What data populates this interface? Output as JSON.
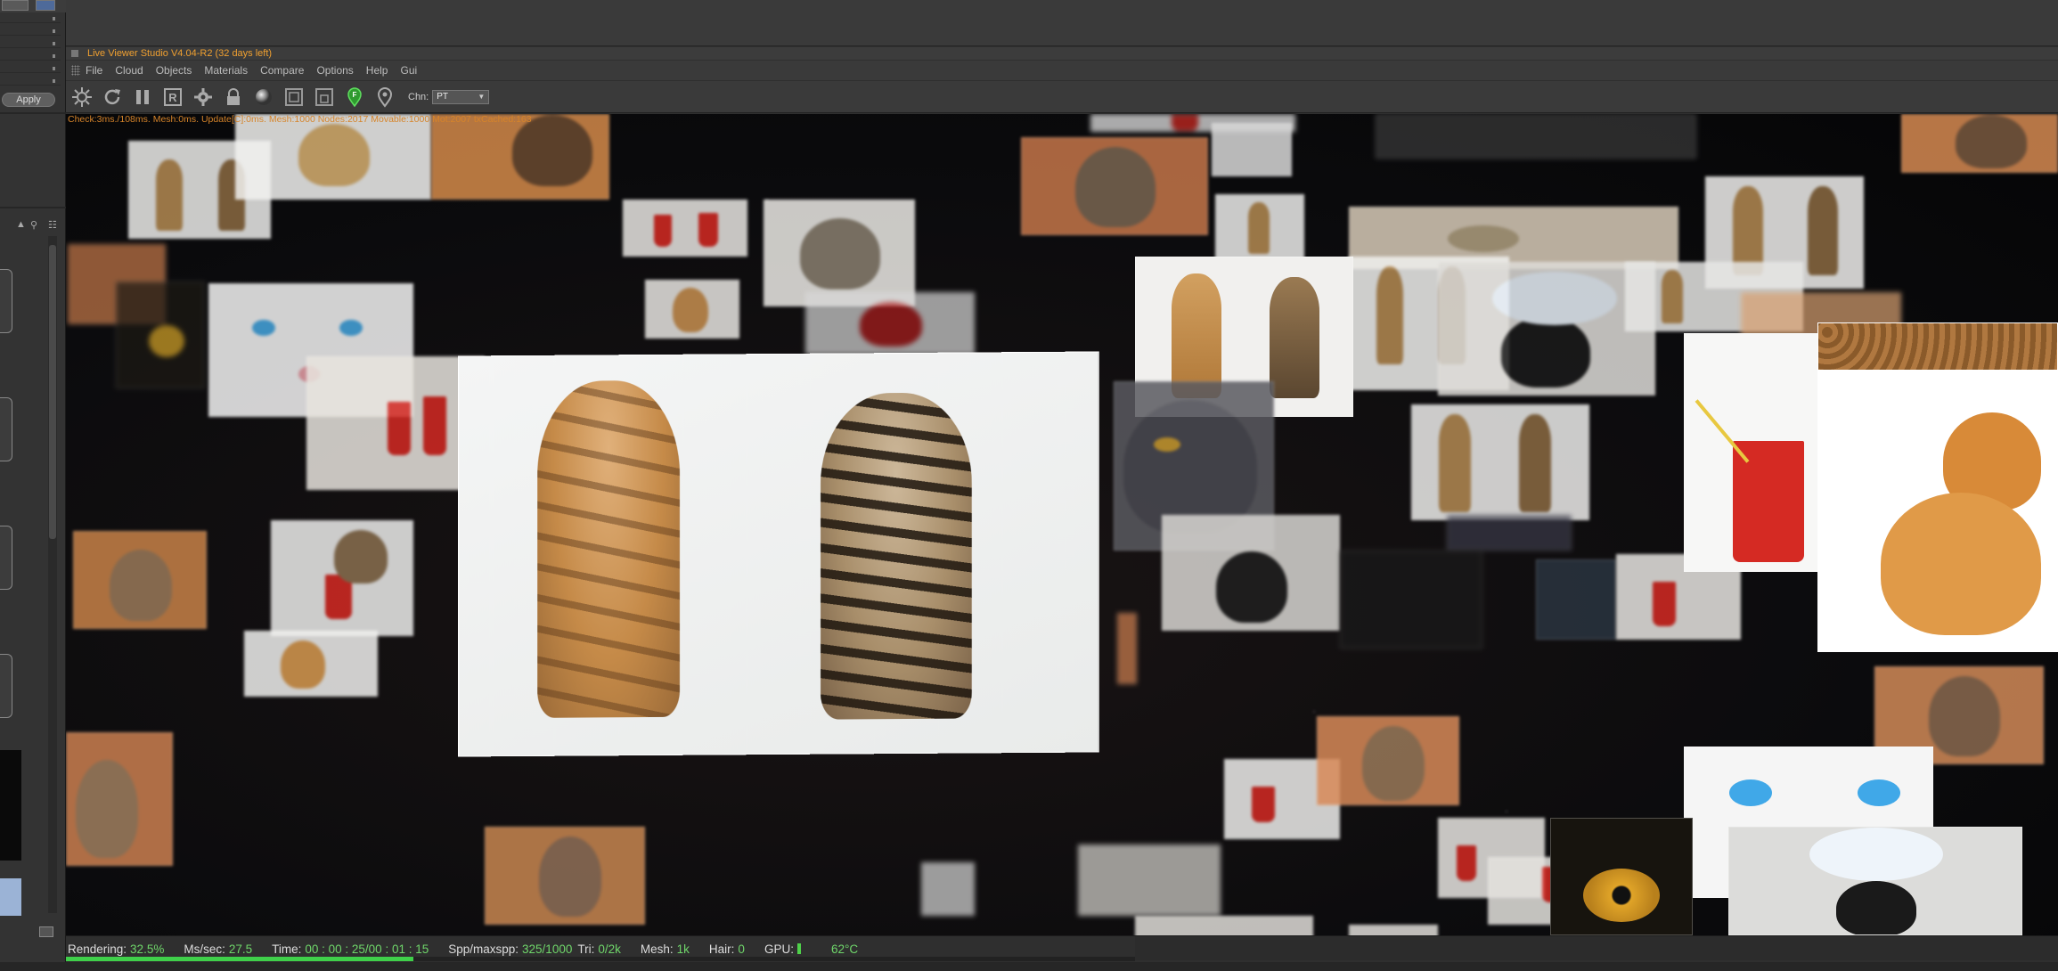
{
  "app": {
    "title": "Live Viewer Studio V4.04-R2 (32 days left)"
  },
  "left_panel": {
    "apply_label": "Apply"
  },
  "menu": {
    "items": [
      "File",
      "Cloud",
      "Objects",
      "Materials",
      "Compare",
      "Options",
      "Help",
      "Gui"
    ]
  },
  "toolbar": {
    "icons": [
      "settings-gear-icon",
      "refresh-icon",
      "pause-icon",
      "render-region-icon",
      "settings-icon",
      "lock-icon",
      "material-ball-icon",
      "viewport-icon",
      "viewport-copy-icon",
      "focus-pin-icon",
      "location-pin-icon"
    ],
    "channel_label": "Chn:",
    "channel_value": "PT"
  },
  "viewport": {
    "stats_line": "Check:3ms./108ms. Mesh:0ms. Update[C]:0ms. Mesh:1000 Nodes:2017 Movable:1000 Mot:2007 txCached:163"
  },
  "status": {
    "rendering_label": "Rendering:",
    "rendering_value": "32.5%",
    "ms_label": "Ms/sec:",
    "ms_value": "27.5",
    "time_label": "Time:",
    "time_value": "00 : 00 : 25/00 : 01 : 15",
    "spp_label": "Spp/maxspp:",
    "spp_value": "325/1000",
    "tri_label": "Tri:",
    "tri_value": "0/2k",
    "mesh_label": "Mesh:",
    "mesh_value": "1k",
    "hair_label": "Hair:",
    "hair_value": "0",
    "gpu_label": "GPU:",
    "gpu_temp": "62°C",
    "progress": 0.325
  },
  "colors": {
    "accent_orange": "#f0a030",
    "status_green": "#6fd66a",
    "progress_green": "#3fd04a"
  }
}
